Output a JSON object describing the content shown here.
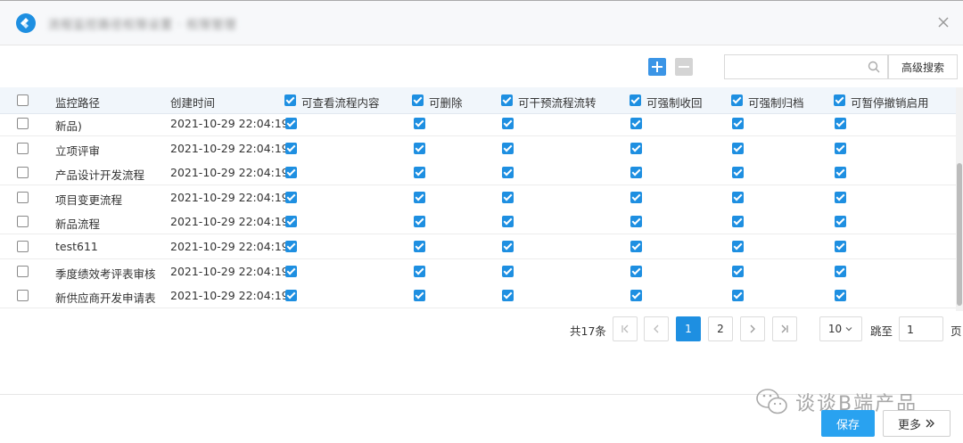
{
  "dialog": {
    "title_blurred": "流程监控路径权限设置 · 权限管理",
    "close_icon": "close-icon"
  },
  "toolbar": {
    "add_icon": "plus-icon",
    "remove_icon": "minus-icon",
    "search_placeholder": "",
    "search_value": "",
    "advanced_search_label": "高级搜索"
  },
  "table": {
    "columns": {
      "path": "监控路径",
      "created": "创建时间",
      "view": "可查看流程内容",
      "delete": "可删除",
      "intervene": "可干预流程流转",
      "recall": "可强制收回",
      "archive": "可强制归档",
      "suspend": "可暂停撤销启用"
    },
    "header_checked": {
      "select_all": false,
      "view": true,
      "delete": true,
      "intervene": true,
      "recall": true,
      "archive": true,
      "suspend": true
    },
    "rows": [
      {
        "path": "新品)",
        "created": "2021-10-29 22:04:19",
        "checked": true
      },
      {
        "path": "立项评审",
        "created": "2021-10-29 22:04:19",
        "checked": true
      },
      {
        "path": "产品设计开发流程",
        "created": "2021-10-29 22:04:19",
        "checked": true
      },
      {
        "path": "项目变更流程",
        "created": "2021-10-29 22:04:19",
        "checked": true
      },
      {
        "path": "新品流程",
        "created": "2021-10-29 22:04:19",
        "checked": true
      },
      {
        "path": "test611",
        "created": "2021-10-29 22:04:19",
        "checked": true
      },
      {
        "path": "季度绩效考评表审核",
        "created": "2021-10-29 22:04:19",
        "checked": true
      },
      {
        "path": "新供应商开发申请表",
        "created": "2021-10-29 22:04:19",
        "checked": true
      }
    ]
  },
  "pagination": {
    "total": "共17条",
    "first_icon": "first-page-icon",
    "prev_icon": "prev-page-icon",
    "pages": [
      "1",
      "2"
    ],
    "current": "1",
    "next_icon": "next-page-icon",
    "last_icon": "last-page-icon",
    "page_size": "10",
    "goto_label": "跳至",
    "goto_value": "1",
    "page_unit": "页"
  },
  "footer": {
    "save_label": "保存",
    "more_label": "更多",
    "watermark_text": "谈谈B端产品"
  },
  "colors": {
    "primary": "#1e8fe1",
    "save_button": "#29a2f0",
    "header_bg": "#f1f6fb"
  }
}
